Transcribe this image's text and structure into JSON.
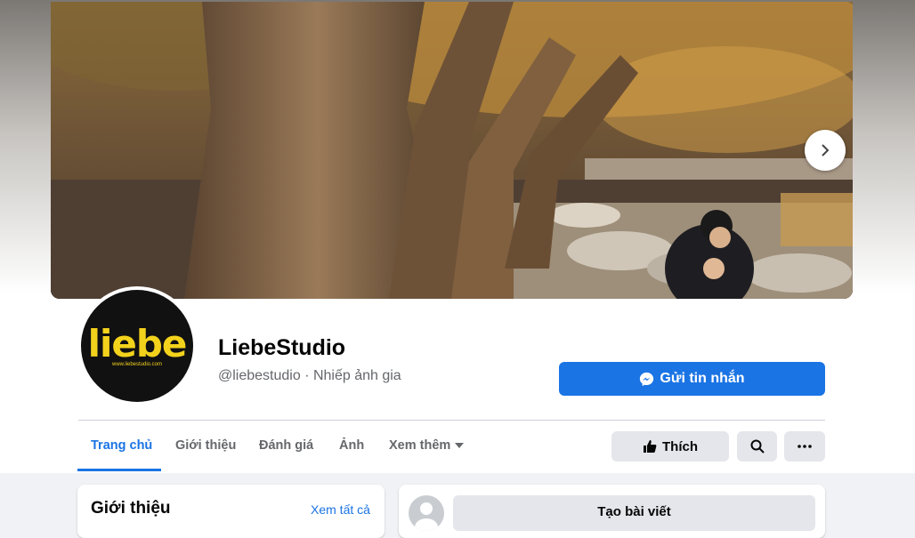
{
  "page": {
    "name": "LiebeStudio",
    "handle_category": "@liebestudio · Nhiếp ảnh gia"
  },
  "logo": {
    "text": "liebe",
    "url": "www.liebestudio.com"
  },
  "actions": {
    "message_label": "Gửi tin nhắn",
    "like_label": "Thích"
  },
  "tabs": [
    {
      "label": "Trang chủ",
      "active": true
    },
    {
      "label": "Giới thiệu",
      "active": false
    },
    {
      "label": "Đánh giá",
      "active": false
    },
    {
      "label": "Ảnh",
      "active": false
    },
    {
      "label": "Xem thêm",
      "active": false
    }
  ],
  "intro": {
    "title": "Giới thiệu",
    "see_all": "Xem tất cả"
  },
  "composer": {
    "placeholder": "Tạo bài viết"
  },
  "colors": {
    "accent": "#1b74e4",
    "logo_yellow": "#f3d21c"
  },
  "icons": [
    "messenger-icon",
    "thumbs-up-icon",
    "search-icon",
    "more-icon",
    "chevron-right-icon",
    "caret-down-icon"
  ]
}
